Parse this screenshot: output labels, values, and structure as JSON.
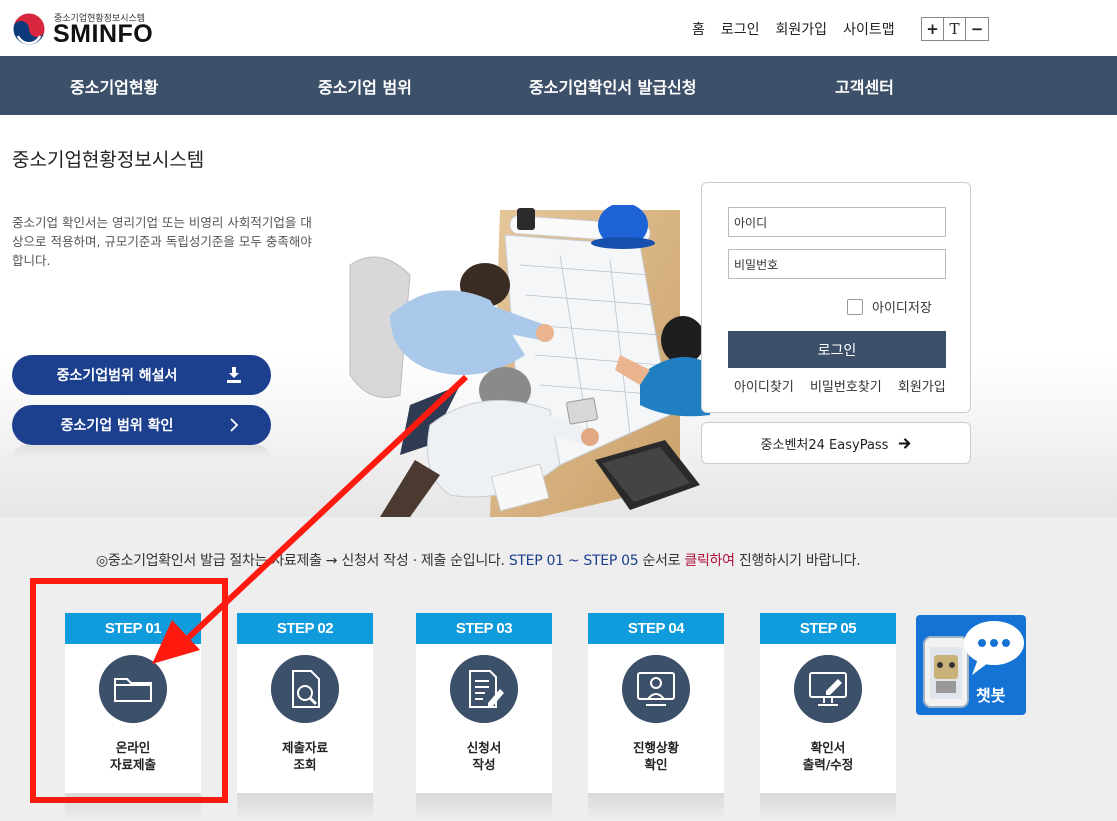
{
  "header": {
    "logo_small": "중소기업현황정보시스템",
    "logo_big": "SMINFO",
    "links": [
      "홈",
      "로그인",
      "회원가입",
      "사이트맵"
    ],
    "font_controls": [
      "+",
      "T",
      "−"
    ]
  },
  "nav": {
    "items": [
      "중소기업현황",
      "중소기업 범위",
      "중소기업확인서 발급신청",
      "고객센터"
    ]
  },
  "hero": {
    "title": "중소기업현황정보시스템",
    "description": "중소기업 확인서는 영리기업 또는 비영리 사회적기업을 대상으로 적용하며, 규모기준과 독립성기준을 모두 충족해야 합니다.",
    "btn_guide": "중소기업범위 해설서",
    "btn_check": "중소기업 범위 확인"
  },
  "login": {
    "id_placeholder": "아이디",
    "pw_placeholder": "비밀번호",
    "save_id": "아이디저장",
    "login_btn": "로그인",
    "links": [
      "아이디찾기",
      "비밀번호찾기",
      "회원가입"
    ],
    "easypass": "중소벤처24 EasyPass"
  },
  "notice": {
    "part1": "◎중소기업확인서 발급 절차는 자료제출 → 신청서 작성 · 제출 순입니다. ",
    "part2": "STEP 01 ~ STEP 05",
    "part3": " 순서로 ",
    "part4": "클릭하여",
    "part5": " 진행하시기 바랍니다."
  },
  "steps": [
    {
      "step": "STEP 01",
      "line1": "온라인",
      "line2": "자료제출",
      "icon": "folder-icon"
    },
    {
      "step": "STEP 02",
      "line1": "제출자료",
      "line2": "조회",
      "icon": "document-search-icon"
    },
    {
      "step": "STEP 03",
      "line1": "신청서",
      "line2": "작성",
      "icon": "document-edit-icon"
    },
    {
      "step": "STEP 04",
      "line1": "진행상황",
      "line2": "확인",
      "icon": "status-monitor-icon"
    },
    {
      "step": "STEP 05",
      "line1": "확인서",
      "line2": "출력/수정",
      "icon": "print-edit-icon"
    }
  ],
  "chatbot": {
    "label": "챗봇"
  },
  "colors": {
    "nav_bg": "#3d5069",
    "button_blue": "#1c3f8e",
    "step_head": "#109bdc",
    "annotation_red": "#ff1a0f"
  }
}
